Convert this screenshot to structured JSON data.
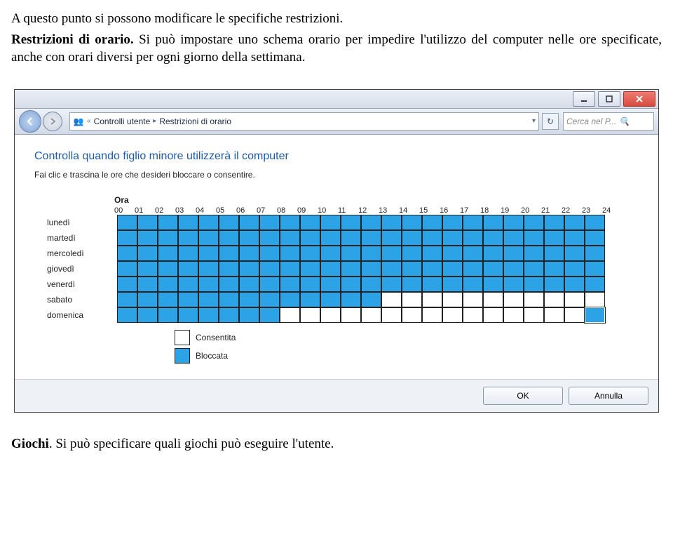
{
  "doc": {
    "p1a": "A questo punto si possono modificare le specifiche restrizioni.",
    "p2_bold": "Restrizioni di orario.",
    "p2_rest": " Si può impostare uno schema orario per impedire l'utilizzo del computer nelle ore specificate, anche con orari diversi per ogni giorno della settimana.",
    "p3_bold": "Giochi",
    "p3_rest": ". Si può specificare quali giochi può eseguire l'utente."
  },
  "window": {
    "breadcrumb": {
      "chevrons": "«",
      "item1": "Controlli utente",
      "item2": "Restrizioni di orario"
    },
    "search_placeholder": "Cerca nel P...",
    "heading": "Controlla quando figlio minore utilizzerà il computer",
    "sub": "Fai clic e trascina le ore che desideri bloccare o consentire.",
    "ora_label": "Ora",
    "hours": [
      "00",
      "01",
      "02",
      "03",
      "04",
      "05",
      "06",
      "07",
      "08",
      "09",
      "10",
      "11",
      "12",
      "13",
      "14",
      "15",
      "16",
      "17",
      "18",
      "19",
      "20",
      "21",
      "22",
      "23",
      "24"
    ],
    "days": [
      "lunedì",
      "martedì",
      "mercoledì",
      "giovedì",
      "venerdì",
      "sabato",
      "domenica"
    ],
    "grid": [
      [
        1,
        1,
        1,
        1,
        1,
        1,
        1,
        1,
        1,
        1,
        1,
        1,
        1,
        1,
        1,
        1,
        1,
        1,
        1,
        1,
        1,
        1,
        1,
        1
      ],
      [
        1,
        1,
        1,
        1,
        1,
        1,
        1,
        1,
        1,
        1,
        1,
        1,
        1,
        1,
        1,
        1,
        1,
        1,
        1,
        1,
        1,
        1,
        1,
        1
      ],
      [
        1,
        1,
        1,
        1,
        1,
        1,
        1,
        1,
        1,
        1,
        1,
        1,
        1,
        1,
        1,
        1,
        1,
        1,
        1,
        1,
        1,
        1,
        1,
        1
      ],
      [
        1,
        1,
        1,
        1,
        1,
        1,
        1,
        1,
        1,
        1,
        1,
        1,
        1,
        1,
        1,
        1,
        1,
        1,
        1,
        1,
        1,
        1,
        1,
        1
      ],
      [
        1,
        1,
        1,
        1,
        1,
        1,
        1,
        1,
        1,
        1,
        1,
        1,
        1,
        1,
        1,
        1,
        1,
        1,
        1,
        1,
        1,
        1,
        1,
        1
      ],
      [
        1,
        1,
        1,
        1,
        1,
        1,
        1,
        1,
        1,
        1,
        1,
        1,
        1,
        0,
        0,
        0,
        0,
        0,
        0,
        0,
        0,
        0,
        0,
        0
      ],
      [
        1,
        1,
        1,
        1,
        1,
        1,
        1,
        1,
        0,
        0,
        0,
        0,
        0,
        0,
        0,
        0,
        0,
        0,
        0,
        0,
        0,
        0,
        0,
        2
      ]
    ],
    "legend": {
      "allowed": "Consentita",
      "blocked": "Bloccata"
    },
    "ok": "OK",
    "cancel": "Annulla"
  }
}
